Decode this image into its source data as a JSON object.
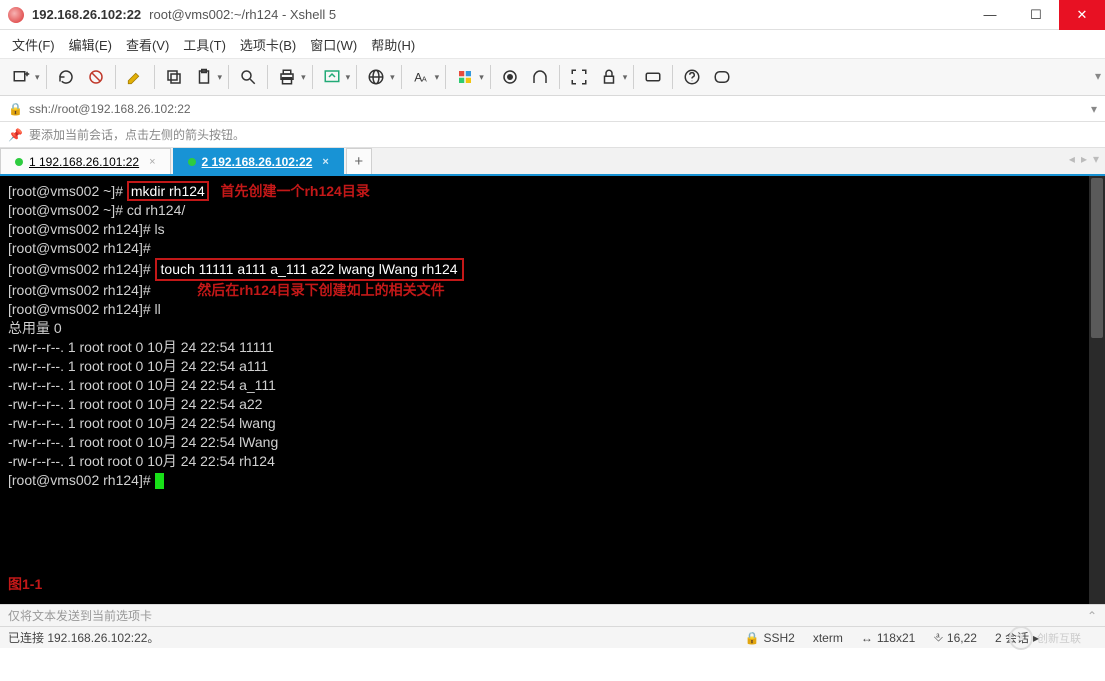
{
  "window": {
    "title_bold": "192.168.26.102:22",
    "title_rest": "root@vms002:~/rh124 - Xshell 5"
  },
  "menu": {
    "file": "文件(F)",
    "edit": "编辑(E)",
    "view": "查看(V)",
    "tools": "工具(T)",
    "tab": "选项卡(B)",
    "window": "窗口(W)",
    "help": "帮助(H)"
  },
  "address": {
    "url": "ssh://root@192.168.26.102:22"
  },
  "hint": {
    "text": "要添加当前会话，点击左侧的箭头按钮。"
  },
  "tabs": {
    "t1": "1 192.168.26.101:22",
    "t2": "2 192.168.26.102:22"
  },
  "term": {
    "l1_prompt": "[root@vms002 ~]# ",
    "l1_cmd": "mkdir rh124",
    "l1_note": "   首先创建一个rh124目录",
    "l2": "[root@vms002 ~]# cd rh124/",
    "l3": "[root@vms002 rh124]# ls",
    "l4": "[root@vms002 rh124]#",
    "l5_prompt": "[root@vms002 rh124]# ",
    "l5_cmd": "touch 11111 a111 a_111 a22 lwang lWang rh124",
    "l6": "[root@vms002 rh124]#",
    "l6_note": "            然后在rh124目录下创建如上的相关文件",
    "l7": "[root@vms002 rh124]# ll",
    "l8": "总用量 0",
    "f1": "-rw-r--r--. 1 root root 0 10月 24 22:54 11111",
    "f2": "-rw-r--r--. 1 root root 0 10月 24 22:54 a111",
    "f3": "-rw-r--r--. 1 root root 0 10月 24 22:54 a_111",
    "f4": "-rw-r--r--. 1 root root 0 10月 24 22:54 a22",
    "f5": "-rw-r--r--. 1 root root 0 10月 24 22:54 lwang",
    "f6": "-rw-r--r--. 1 root root 0 10月 24 22:54 lWang",
    "f7": "-rw-r--r--. 1 root root 0 10月 24 22:54 rh124",
    "lend": "[root@vms002 rh124]# ",
    "fig": "图1-1"
  },
  "sendbar": {
    "text": "仅将文本发送到当前选项卡"
  },
  "status": {
    "conn": "已连接 192.168.26.102:22。",
    "ssh": "SSH2",
    "term": "xterm",
    "size": "118x21",
    "cursor": "16,22",
    "sessions": "2 会话"
  },
  "watermark": {
    "text": "创新互联"
  }
}
